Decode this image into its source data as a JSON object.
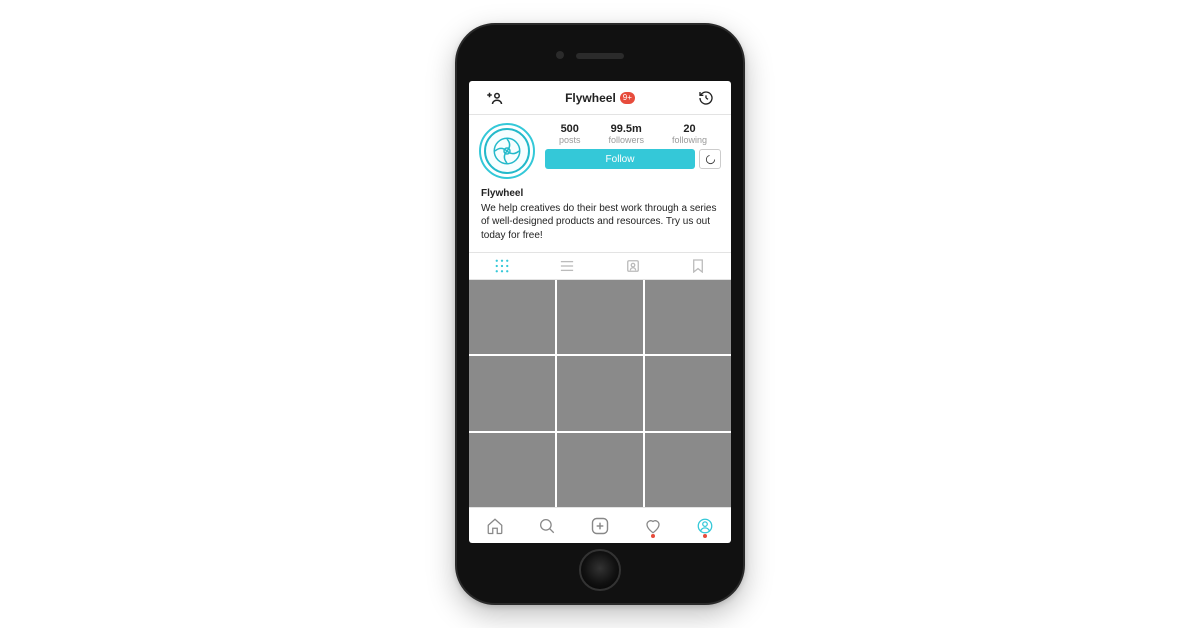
{
  "header": {
    "title": "Flywheel",
    "notification_badge": "9+"
  },
  "profile": {
    "stats": {
      "posts": {
        "value": "500",
        "label": "posts"
      },
      "followers": {
        "value": "99.5m",
        "label": "followers"
      },
      "following": {
        "value": "20",
        "label": "following"
      }
    },
    "follow_label": "Follow"
  },
  "bio": {
    "name": "Flywheel",
    "text": "We help creatives do their best work through a series of well-designed products and resources. Try us out today for free!"
  },
  "colors": {
    "accent": "#34c8d8",
    "badge": "#e74c3c",
    "placeholder": "#8a8a8a"
  }
}
